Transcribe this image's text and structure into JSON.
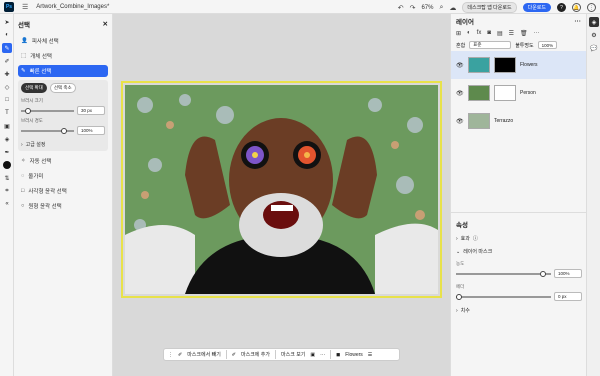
{
  "app": {
    "logo": "Ps",
    "doc_title": "Artwork_Combine_Images*",
    "zoom": "67%"
  },
  "topbar": {
    "download_label": "데스크탑 앱 다운로드",
    "share_label": "다운로드"
  },
  "selection_panel": {
    "title": "선택",
    "items": [
      "피사체 선택",
      "개체 선택",
      "빠른 선택"
    ],
    "mode_add": "선택 확대",
    "mode_sub": "선택 축소",
    "brush_size_label": "브러시 크기",
    "brush_size_value": "30 px",
    "brush_hardness_label": "브러시 경도",
    "brush_hardness_value": "100%",
    "advanced_label": "고급 설정",
    "lower_items": [
      "자동 선택",
      "올가미",
      "사각형 윤곽 선택",
      "원형 윤곽 선택"
    ]
  },
  "layers_panel": {
    "title": "레이어",
    "blend_label": "혼합",
    "blend_value": "표준",
    "opacity_label": "불투명도",
    "opacity_value": "100%",
    "layers": [
      {
        "name": "Flowers",
        "selected": true
      },
      {
        "name": "Person",
        "selected": false
      },
      {
        "name": "Terrazzo",
        "selected": false
      }
    ]
  },
  "properties": {
    "title": "속성",
    "effects_label": "효과",
    "mask_section": "레이어 마스크",
    "density_label": "농도",
    "density_value": "100%",
    "feather_label": "페더",
    "feather_value": "0 px",
    "size_label": "치수"
  },
  "floatbar": {
    "subtract_label": "마스크에서 빼기",
    "add_label": "마스크에 추가",
    "view_label": "마스크 보기",
    "layer_label": "Flowers"
  },
  "colors": {
    "accent": "#2c67f2",
    "artboard_border": "#e8e24a"
  }
}
